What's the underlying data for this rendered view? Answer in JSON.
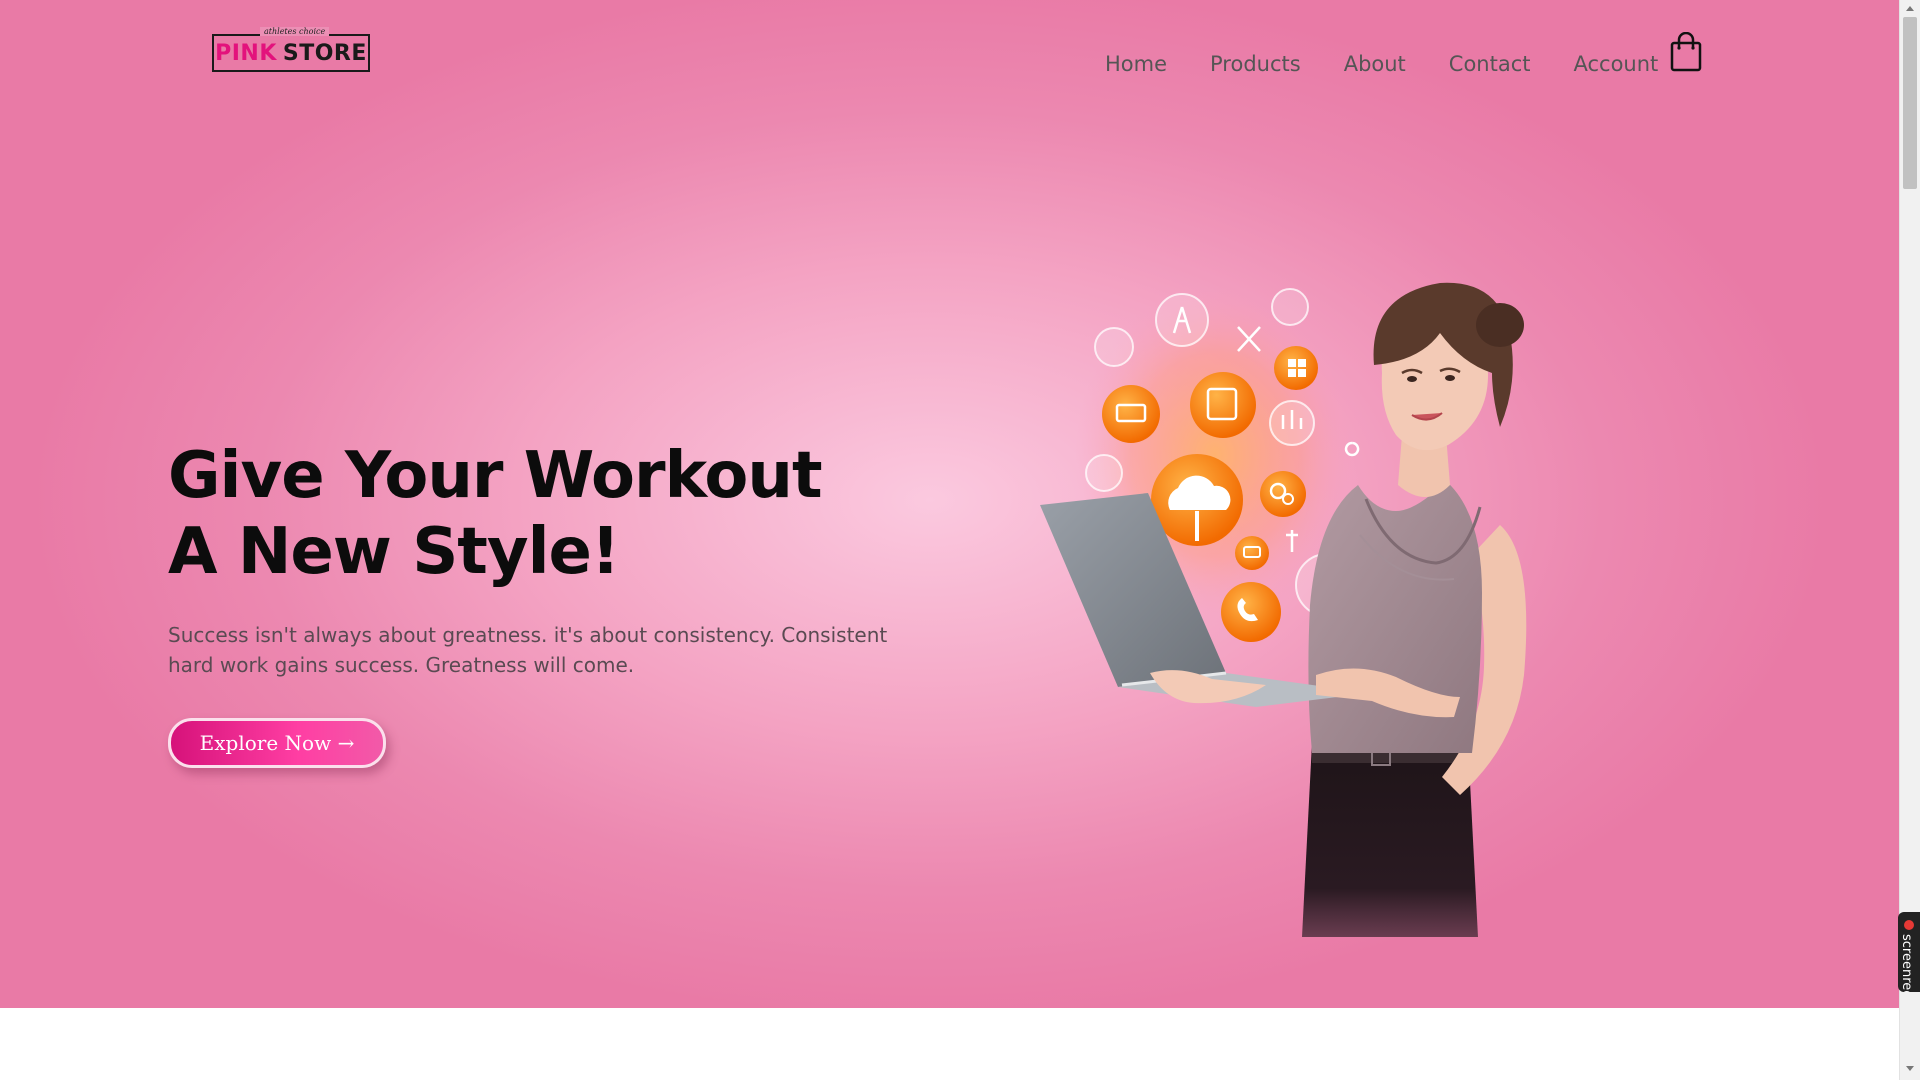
{
  "brand": {
    "tagline": "athletes choice",
    "name_part1": "PINK",
    "name_part2": "STORE",
    "pink_color": "#e3127c"
  },
  "nav": {
    "items": [
      {
        "label": "Home"
      },
      {
        "label": "Products"
      },
      {
        "label": "About"
      },
      {
        "label": "Contact"
      },
      {
        "label": "Account"
      }
    ],
    "cart_icon": "shopping-bag-icon"
  },
  "hero": {
    "headline_line1": "Give Your Workout",
    "headline_line2": "A New Style!",
    "subtext": "Success isn't always about greatness. it's about consistency. Consistent hard work gains success. Greatness will come.",
    "cta_label": "Explore Now →",
    "background_color": "#ec88b0",
    "accent_color": "#ff3ea3"
  },
  "recorder_tab": {
    "label": "screenrec"
  }
}
